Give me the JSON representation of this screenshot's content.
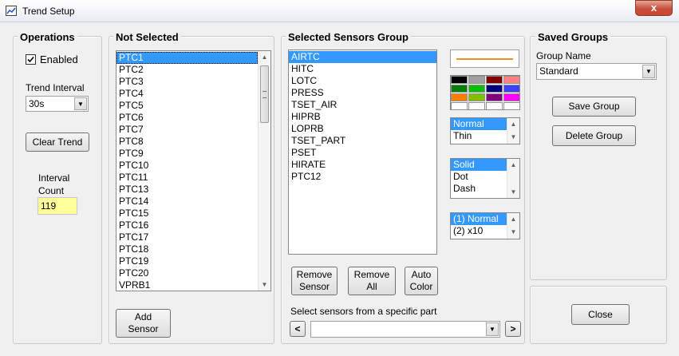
{
  "window": {
    "title": "Trend Setup",
    "close_glyph": "x"
  },
  "operations": {
    "legend": "Operations",
    "enabled_label": "Enabled",
    "enabled_checked": true,
    "trend_interval_label": "Trend Interval",
    "trend_interval_value": "30s",
    "clear_trend_label": "Clear Trend",
    "interval_count_label_1": "Interval",
    "interval_count_label_2": "Count",
    "interval_count_value": "119"
  },
  "not_selected": {
    "legend": "Not Selected",
    "items": [
      "PTC1",
      "PTC2",
      "PTC3",
      "PTC4",
      "PTC5",
      "PTC6",
      "PTC7",
      "PTC8",
      "PTC9",
      "PTC10",
      "PTC11",
      "PTC13",
      "PTC14",
      "PTC15",
      "PTC16",
      "PTC17",
      "PTC18",
      "PTC19",
      "PTC20",
      "VPRB1"
    ],
    "selected_index": 0,
    "add_sensor_label_1": "Add",
    "add_sensor_label_2": "Sensor"
  },
  "selected_group": {
    "legend": "Selected Sensors Group",
    "items": [
      "AIRTC",
      "HITC",
      "LOTC",
      "PRESS",
      "TSET_AIR",
      "HIPRB",
      "LOPRB",
      "TSET_PART",
      "PSET",
      "HIRATE",
      "PTC12"
    ],
    "selected_index": 0,
    "line_color": "#f0901a",
    "palette": [
      [
        "#000000",
        "#a0a0a0",
        "#800000",
        "#ff8080"
      ],
      [
        "#008000",
        "#00c000",
        "#000080",
        "#4040ff"
      ],
      [
        "#ff8000",
        "#80c000",
        "#800080",
        "#ff00ff"
      ],
      [
        "#ffffff",
        "#ffffff",
        "#ffffff",
        "#ffffff"
      ]
    ],
    "width_options": [
      "Normal",
      "Thin"
    ],
    "width_selected": 0,
    "style_options": [
      "Solid",
      "Dot",
      "Dash"
    ],
    "style_selected": 0,
    "scale_options": [
      "(1) Normal",
      "(2) x10"
    ],
    "scale_selected": 0,
    "remove_sensor_label_1": "Remove",
    "remove_sensor_label_2": "Sensor",
    "remove_all_label_1": "Remove",
    "remove_all_label_2": "All",
    "auto_color_label_1": "Auto",
    "auto_color_label_2": "Color",
    "part_label": "Select sensors from a specific part",
    "part_value": "",
    "prev_label": "<",
    "next_label": ">"
  },
  "saved_groups": {
    "legend": "Saved Groups",
    "group_name_label": "Group Name",
    "group_name_value": "Standard",
    "save_label": "Save Group",
    "delete_label": "Delete Group"
  },
  "footer": {
    "close_label": "Close"
  }
}
